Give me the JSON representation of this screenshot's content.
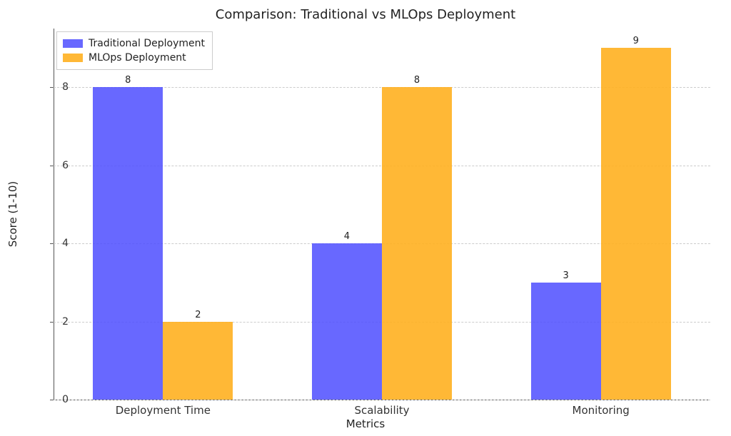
{
  "chart_data": {
    "type": "bar",
    "title": "Comparison: Traditional vs MLOps Deployment",
    "xlabel": "Metrics",
    "ylabel": "Score (1-10)",
    "categories": [
      "Deployment Time",
      "Scalability",
      "Monitoring"
    ],
    "series": [
      {
        "name": "Traditional Deployment",
        "values": [
          8,
          4,
          3
        ],
        "color": "#4d4dff",
        "alpha": 0.85
      },
      {
        "name": "MLOps Deployment",
        "values": [
          2,
          8,
          9
        ],
        "color": "#ffb020",
        "alpha": 0.9
      }
    ],
    "ylim": [
      0,
      9.5
    ],
    "yticks": [
      0,
      2,
      4,
      6,
      8
    ],
    "legend_position": "upper-left",
    "grid": {
      "axis": "y",
      "style": "dashed"
    }
  }
}
